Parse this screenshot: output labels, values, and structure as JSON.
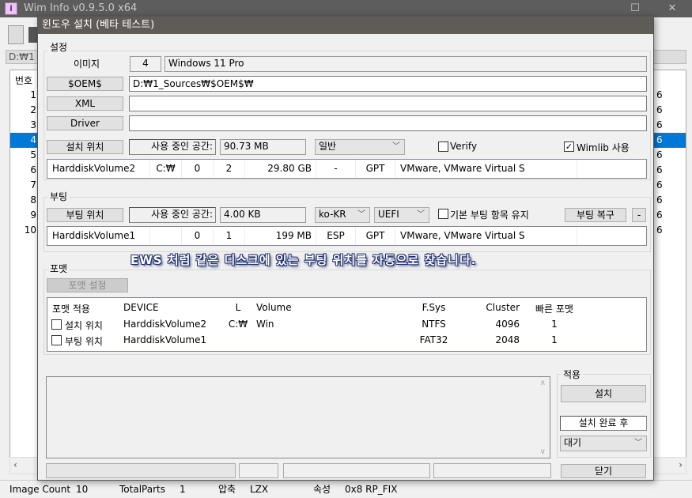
{
  "app": {
    "title": "Wim Info v0.9.5.0 x64",
    "path_prefix": "D:₩1 S",
    "list_header": "번호",
    "rows": [
      "1",
      "2",
      "3",
      "4",
      "5",
      "6",
      "7",
      "8",
      "9",
      "10"
    ],
    "selected_index": 3,
    "right_col_values": [
      "6",
      "6",
      "6",
      "6",
      "6",
      "6",
      "6",
      "6",
      "6",
      "6"
    ]
  },
  "statusbar": {
    "image_count_label": "Image Count",
    "image_count": "10",
    "total_parts_label": "TotalParts",
    "total_parts": "1",
    "compression_label": "압축",
    "compression": "LZX",
    "attr_label": "속성",
    "attr": "0x8 RP_FIX"
  },
  "dialog": {
    "title": "윈도우 설치 (베타 테스트)",
    "settings": {
      "group_label": "설정",
      "image_label": "이미지",
      "image_index": "4",
      "image_name": "Windows 11 Pro",
      "oem_button": "$OEM$",
      "oem_path": "D:₩1_Sources₩$OEM$₩",
      "xml_button": "XML",
      "xml_path": "",
      "driver_button": "Driver",
      "driver_path": "",
      "install_loc_button": "설치 위치",
      "used_space_label": "사용 중인 공간:",
      "used_space": "90.73 MB",
      "mode_combo": "일반",
      "verify_label": "Verify",
      "verify_checked": false,
      "wimlib_label": "Wimlib 사용",
      "wimlib_checked": true,
      "disk": [
        "HarddiskVolume2",
        "C:₩",
        "0",
        "2",
        "29.80 GB",
        "-",
        "GPT",
        "VMware, VMware Virtual S",
        ""
      ]
    },
    "boot": {
      "group_label": "부팅",
      "boot_loc_button": "부팅 위치",
      "used_space_label": "사용 중인 공간:",
      "used_space": "4.00 KB",
      "locale_combo": "ko-KR",
      "firmware_combo": "UEFI",
      "keep_default_label": "기본 부팅 항목 유지",
      "keep_default_checked": false,
      "repair_button": "부팅 복구",
      "minus_button": "-",
      "disk": [
        "HarddiskVolume1",
        "",
        "0",
        "1",
        "199 MB",
        "ESP",
        "GPT",
        "VMware, VMware Virtual S",
        ""
      ]
    },
    "overlay_text": "EWS 처럼 같은 디스크에 있는 부팅 위치를 자동으로 찾습니다.",
    "format": {
      "group_label": "포맷",
      "settings_button": "포맷 설정",
      "columns": [
        "포맷 적용",
        "DEVICE",
        "L",
        "Volume",
        "F.Sys",
        "Cluster",
        "빠른 포맷"
      ],
      "rows": [
        [
          "설치 위치",
          "HarddiskVolume2",
          "C:₩",
          "Win",
          "NTFS",
          "4096",
          "1"
        ],
        [
          "부팅 위치",
          "HarddiskVolume1",
          "",
          "",
          "FAT32",
          "2048",
          "1"
        ]
      ]
    },
    "apply": {
      "group_label": "적용",
      "install_button": "설치",
      "after_label": "설치 완료 후",
      "after_combo": "대기"
    },
    "close_button": "닫기"
  }
}
